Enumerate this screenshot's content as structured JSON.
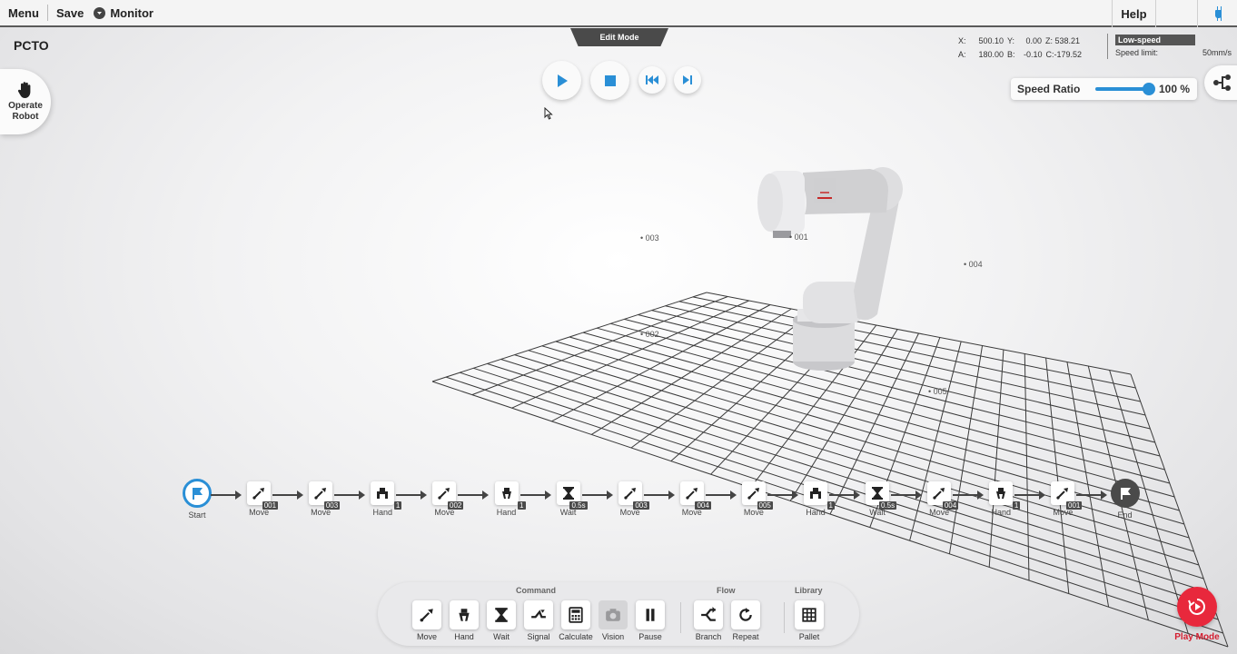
{
  "topbar": {
    "menu": "Menu",
    "save": "Save",
    "monitor": "Monitor",
    "help": "Help"
  },
  "page_title": "PCTO",
  "operate_robot": "Operate Robot",
  "edit_mode": "Edit Mode",
  "coords": {
    "x_label": "X:",
    "x_value": "500.10",
    "y_label": "Y:",
    "y_value": "0.00",
    "z_label": "Z:",
    "z_value": "538.21",
    "a_label": "A:",
    "a_value": "180.00",
    "b_label": "B:",
    "b_value": "-0.10",
    "c_label": "C:",
    "c_value": "-179.52"
  },
  "speed": {
    "mode": "Low-speed",
    "limit_label": "Speed limit:",
    "limit_value": "50mm/s",
    "ratio_label": "Speed Ratio",
    "ratio_value": "100 %",
    "ratio_fraction": 1.0
  },
  "waypoints": [
    "003",
    "001",
    "004",
    "002",
    "005"
  ],
  "flow": [
    {
      "label": "Start",
      "icon": "start-flag-icon"
    },
    {
      "label": "Move",
      "icon": "move-icon",
      "badge": "001"
    },
    {
      "label": "Move",
      "icon": "move-icon",
      "badge": "003"
    },
    {
      "label": "Hand",
      "icon": "hand-open-icon",
      "badge": "1"
    },
    {
      "label": "Move",
      "icon": "move-icon",
      "badge": "002"
    },
    {
      "label": "Hand",
      "icon": "hand-close-icon",
      "badge": "1"
    },
    {
      "label": "Wait",
      "icon": "hourglass-icon",
      "badge": "0.5s"
    },
    {
      "label": "Move",
      "icon": "move-icon",
      "badge": "003"
    },
    {
      "label": "Move",
      "icon": "move-icon",
      "badge": "004"
    },
    {
      "label": "Move",
      "icon": "move-icon",
      "badge": "005"
    },
    {
      "label": "Hand",
      "icon": "hand-open-icon",
      "badge": "1"
    },
    {
      "label": "Wait",
      "icon": "hourglass-icon",
      "badge": "0.5s"
    },
    {
      "label": "Move",
      "icon": "move-icon",
      "badge": "004"
    },
    {
      "label": "Hand",
      "icon": "hand-close-icon",
      "badge": "1"
    },
    {
      "label": "Move",
      "icon": "move-icon",
      "badge": "001"
    },
    {
      "label": "End",
      "icon": "end-flag-icon"
    }
  ],
  "palette": {
    "command_label": "Command",
    "flow_label": "Flow",
    "library_label": "Library",
    "buttons": [
      {
        "label": "Move",
        "icon": "move-icon"
      },
      {
        "label": "Hand",
        "icon": "hand-icon"
      },
      {
        "label": "Wait",
        "icon": "hourglass-icon"
      },
      {
        "label": "Signal",
        "icon": "signal-icon"
      },
      {
        "label": "Calculate",
        "icon": "calculator-icon"
      },
      {
        "label": "Vision",
        "icon": "camera-icon",
        "disabled": true
      },
      {
        "label": "Pause",
        "icon": "pause-icon"
      },
      {
        "label": "Branch",
        "icon": "branch-icon"
      },
      {
        "label": "Repeat",
        "icon": "repeat-icon"
      },
      {
        "label": "Pallet",
        "icon": "pallet-icon"
      }
    ]
  },
  "play_mode": "Play Mode",
  "colors": {
    "accent_blue": "#2a8fd6",
    "play_mode_red": "#e8283c",
    "dark_gray": "#4a4a4a"
  }
}
